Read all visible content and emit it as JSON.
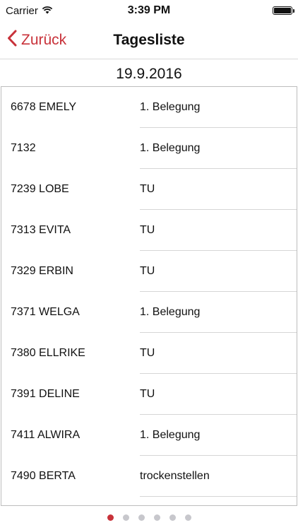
{
  "status_bar": {
    "carrier": "Carrier",
    "time": "3:39 PM",
    "wifi_icon": "wifi-icon",
    "battery_icon": "battery-icon",
    "battery_level": 1.0
  },
  "nav": {
    "back_label": "Zurück",
    "title": "Tagesliste",
    "accent_color": "#c8323a"
  },
  "date": "19.9.2016",
  "list": {
    "rows": [
      {
        "name": "6678 EMELY",
        "status": "1. Belegung"
      },
      {
        "name": "7132",
        "status": "1. Belegung"
      },
      {
        "name": "7239 LOBE",
        "status": "TU"
      },
      {
        "name": "7313 EVITA",
        "status": "TU"
      },
      {
        "name": "7329 ERBIN",
        "status": "TU"
      },
      {
        "name": "7371 WELGA",
        "status": "1. Belegung"
      },
      {
        "name": "7380 ELLRIKE",
        "status": "TU"
      },
      {
        "name": "7391 DELINE",
        "status": "TU"
      },
      {
        "name": "7411 ALWIRA",
        "status": "1. Belegung"
      },
      {
        "name": "7490 BERTA",
        "status": "trockenstellen"
      }
    ]
  },
  "pager": {
    "page_count": 6,
    "current_page": 1
  }
}
